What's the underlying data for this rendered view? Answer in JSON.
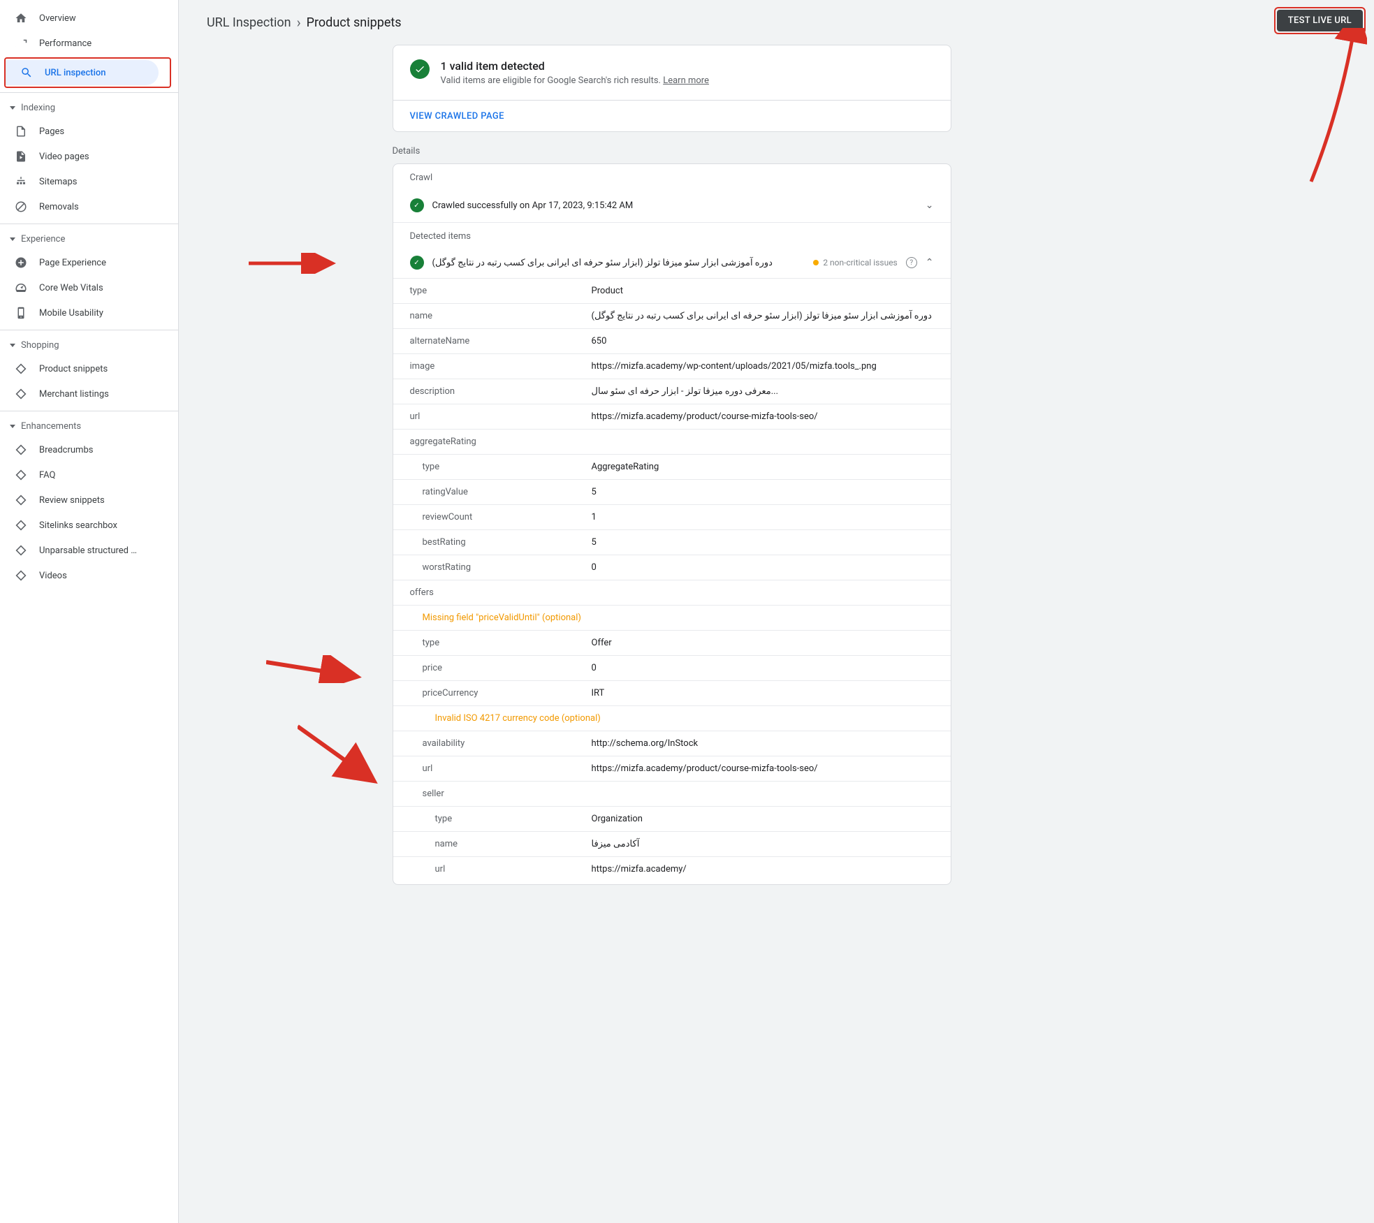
{
  "sidebar": {
    "overview": "Overview",
    "performance": "Performance",
    "url_inspection": "URL inspection",
    "indexing": "Indexing",
    "pages": "Pages",
    "video_pages": "Video pages",
    "sitemaps": "Sitemaps",
    "removals": "Removals",
    "experience": "Experience",
    "page_experience": "Page Experience",
    "cwv": "Core Web Vitals",
    "mobile": "Mobile Usability",
    "shopping": "Shopping",
    "product_snippets": "Product snippets",
    "merchant": "Merchant listings",
    "enhancements": "Enhancements",
    "breadcrumbs": "Breadcrumbs",
    "faq": "FAQ",
    "review": "Review snippets",
    "sitelinks": "Sitelinks searchbox",
    "unparsable": "Unparsable structured …",
    "videos": "Videos"
  },
  "breadcrumb": {
    "a": "URL Inspection",
    "b": "Product snippets"
  },
  "test_live": "TEST LIVE URL",
  "summary": {
    "title": "1 valid item detected",
    "subtitle": "Valid items are eligible for Google Search's rich results. ",
    "learn": "Learn more"
  },
  "view_crawled": "VIEW CRAWLED PAGE",
  "details_label": "Details",
  "crawl": {
    "hdr": "Crawl",
    "text": "Crawled successfully on Apr 17, 2023, 9:15:42 AM"
  },
  "detected_label": "Detected items",
  "item": {
    "name": "دوره آموزشی ابزار سئو میزفا تولز (ابزار سئو حرفه ای ایرانی برای کسب رتبه در نتایج گوگل)",
    "issues": "2 non-critical issues"
  },
  "kv": {
    "type": {
      "k": "type",
      "v": "Product"
    },
    "name": {
      "k": "name",
      "v": "دوره آموزشی ابزار سئو میزفا تولز (ابزار سئو حرفه ای ایرانی برای کسب رتبه در نتایج گوگل)"
    },
    "alt": {
      "k": "alternateName",
      "v": "650"
    },
    "image": {
      "k": "image",
      "v": "https://mizfa.academy/wp-content/uploads/2021/05/mizfa.tools_.png"
    },
    "desc": {
      "k": "description",
      "v": "...معرفی دوره میزفا تولز - ابزار حرفه ای سئو سال"
    },
    "url": {
      "k": "url",
      "v": "https://mizfa.academy/product/course-mizfa-tools-seo/"
    },
    "agg": {
      "k": "aggregateRating"
    },
    "agg_type": {
      "k": "type",
      "v": "AggregateRating"
    },
    "rating": {
      "k": "ratingValue",
      "v": "5"
    },
    "reviewc": {
      "k": "reviewCount",
      "v": "1"
    },
    "best": {
      "k": "bestRating",
      "v": "5"
    },
    "worst": {
      "k": "worstRating",
      "v": "0"
    },
    "offers": {
      "k": "offers"
    },
    "warn1": "Missing field \"priceValidUntil\" (optional)",
    "off_type": {
      "k": "type",
      "v": "Offer"
    },
    "price": {
      "k": "price",
      "v": "0"
    },
    "currency": {
      "k": "priceCurrency",
      "v": "IRT"
    },
    "warn2": "Invalid ISO 4217 currency code (optional)",
    "avail": {
      "k": "availability",
      "v": "http://schema.org/InStock"
    },
    "off_url": {
      "k": "url",
      "v": "https://mizfa.academy/product/course-mizfa-tools-seo/"
    },
    "seller": {
      "k": "seller"
    },
    "sel_type": {
      "k": "type",
      "v": "Organization"
    },
    "sel_name": {
      "k": "name",
      "v": "آکادمی میزفا"
    },
    "sel_url": {
      "k": "url",
      "v": "https://mizfa.academy/"
    }
  }
}
